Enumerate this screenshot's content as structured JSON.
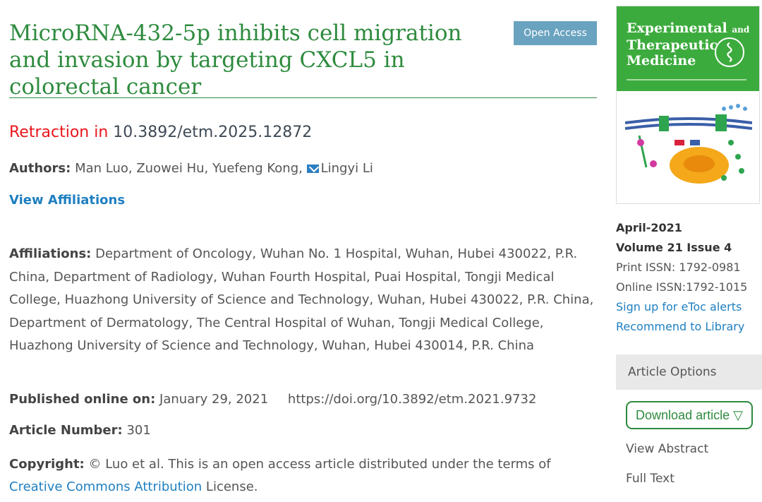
{
  "article": {
    "title": "MicroRNA-432-5p inhibits cell migration and invasion by targeting CXCL5 in colorectal cancer",
    "open_access_label": "Open Access",
    "retraction_prefix": "Retraction in",
    "retraction_doi": "10.3892/etm.2025.12872",
    "authors_label": "Authors:",
    "authors": "Man Luo, Zuowei Hu, Yuefeng Kong,",
    "corresponding_author": "Lingyi Li",
    "view_affiliations": "View Affiliations",
    "affiliations_label": "Affiliations:",
    "affiliations_text": "Department of Oncology, Wuhan No. 1 Hospital, Wuhan, Hubei 430022, P.R. China, Department of Radiology, Wuhan Fourth Hospital, Puai Hospital, Tongji Medical College, Huazhong University of Science and Technology, Wuhan, Hubei 430022, P.R. China, Department of Dermatology, The Central Hospital of Wuhan, Tongji Medical College, Huazhong University of Science and Technology, Wuhan, Hubei 430014, P.R. China",
    "published_label": "Published online on:",
    "published_date": "January 29, 2021",
    "doi_url": "https://doi.org/10.3892/etm.2021.9732",
    "article_number_label": "Article Number:",
    "article_number": "301",
    "copyright_label": "Copyright:",
    "copyright_text": "© Luo et al. This is an open access article distributed under the terms of",
    "license_link": "Creative Commons Attribution",
    "license_suffix": "License."
  },
  "sidebar": {
    "journal_title_line1": "Experimental",
    "journal_title_and": "and",
    "journal_title_line2": "Therapeutic",
    "journal_title_line3": "Medicine",
    "issue_date": "April-2021",
    "volume_issue": "Volume 21 Issue 4",
    "print_issn": "Print ISSN: 1792-0981",
    "online_issn": "Online ISSN:1792-1015",
    "etoc_link": "Sign up for eToc alerts",
    "recommend_link": "Recommend to Library",
    "options_header": "Article Options",
    "download_label": "Download article ▽",
    "view_abstract": "View Abstract",
    "full_text": "Full Text"
  },
  "colors": {
    "title_green": "#2e8b3e",
    "retraction_red": "#e8161c",
    "link_blue": "#1f7fc1",
    "badge_blue": "#6aa3bf",
    "cover_green": "#3cab3d"
  }
}
